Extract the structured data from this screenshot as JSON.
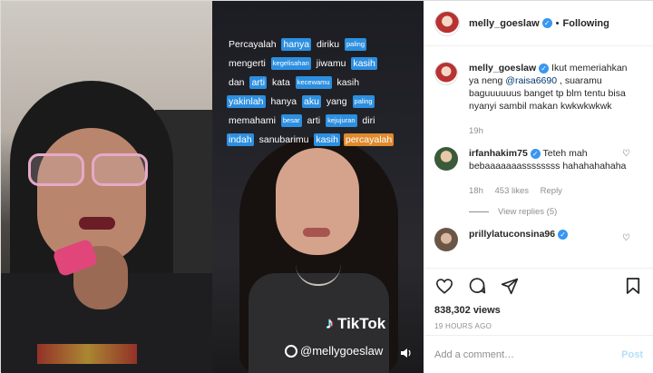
{
  "media": {
    "lyrics": [
      [
        {
          "t": "Percayalah",
          "s": ""
        },
        {
          "t": "hanya",
          "s": "hl"
        },
        {
          "t": "diriku",
          "s": ""
        },
        {
          "t": "paling",
          "s": "hl sm"
        }
      ],
      [
        {
          "t": "mengerti",
          "s": ""
        },
        {
          "t": "kegelisahan",
          "s": "hl sm"
        },
        {
          "t": "jiwamu",
          "s": ""
        },
        {
          "t": "kasih",
          "s": "hl"
        }
      ],
      [
        {
          "t": "dan",
          "s": ""
        },
        {
          "t": "arti",
          "s": "hl"
        },
        {
          "t": "kata",
          "s": ""
        },
        {
          "t": "kecewamu",
          "s": "hl sm"
        },
        {
          "t": "kasih",
          "s": ""
        }
      ],
      [
        {
          "t": "yakinlah",
          "s": "hl"
        },
        {
          "t": "hanya",
          "s": ""
        },
        {
          "t": "aku",
          "s": "hl"
        },
        {
          "t": "yang",
          "s": ""
        },
        {
          "t": "paling",
          "s": "hl sm"
        }
      ],
      [
        {
          "t": "memahami",
          "s": ""
        },
        {
          "t": "besar",
          "s": "hl sm"
        },
        {
          "t": "arti",
          "s": ""
        },
        {
          "t": "kejujuran",
          "s": "hl sm"
        },
        {
          "t": "diri",
          "s": ""
        }
      ],
      [
        {
          "t": "indah",
          "s": "hl"
        },
        {
          "t": "sanubarimu",
          "s": ""
        },
        {
          "t": "kasih",
          "s": "hl"
        },
        {
          "t": "percayalah",
          "s": "or"
        }
      ]
    ],
    "watermark": "TikTok",
    "watermark_user": "@mellygoeslaw"
  },
  "header": {
    "username": "melly_goeslaw",
    "separator": "•",
    "follow_label": "Following"
  },
  "caption": {
    "username": "melly_goeslaw",
    "text_before": " Ikut memeriahkan ya neng ",
    "mention": "@raisa6690",
    "text_after": " , suaramu baguuuuuus banget tp blm tentu bisa nyanyi sambil makan kwkwkwkwk",
    "time": "19h"
  },
  "comments": [
    {
      "username": "irfanhakim75",
      "text": " Teteh mah bebaaaaaaassssssss hahahahahaha",
      "time": "18h",
      "likes": "453 likes",
      "reply_label": "Reply",
      "view_replies": "View replies (5)"
    },
    {
      "username": "prillylatuconsina96"
    }
  ],
  "actions": {
    "views": "838,302 views",
    "posted_ago": "19 HOURS AGO"
  },
  "add_comment": {
    "placeholder": "Add a comment…",
    "post_label": "Post"
  },
  "colors": {
    "verified": "#3897f0",
    "highlight": "#2d8fe0",
    "highlight_last": "#e08a2b",
    "post_disabled": "#b2dffc"
  }
}
